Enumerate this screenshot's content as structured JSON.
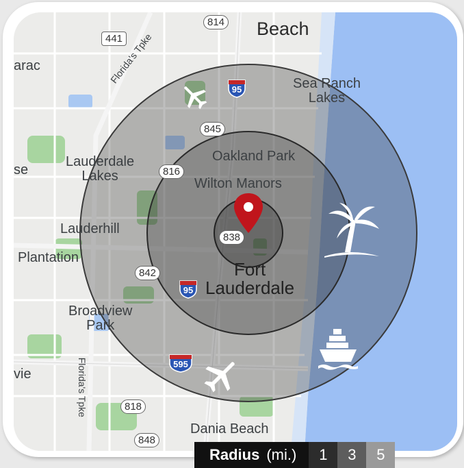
{
  "map": {
    "labels": {
      "pompano_beach": "Beach",
      "tamarac": "arac",
      "sea_ranch_lakes": "Sea Ranch\nLakes",
      "lauderdale_lakes": "Lauderdale\nLakes",
      "oakland_park": "Oakland Park",
      "wilton_manors": "Wilton Manors",
      "sunrise": "se",
      "lauderhill": "Lauderhill",
      "plantation": "Plantation",
      "fort_lauderdale": "Fort\nLauderdale",
      "broadview_park": "Broadview\nPark",
      "davie": "vie",
      "dania_beach": "Dania Beach",
      "florida_tpke_1": "Florida's Tpke",
      "florida_tpke_2": "Florida's Tpke"
    },
    "shields": {
      "s814": "814",
      "s441": "441",
      "s845": "845",
      "s816": "816",
      "s838": "838",
      "s842": "842",
      "s818": "818",
      "s848": "848",
      "i95_top": "95",
      "i95_mid": "95",
      "i595": "595"
    },
    "markers": {
      "center_pin": "map-pin-icon",
      "airport_north": "airplane-icon",
      "airport_south": "airplane-icon",
      "beach": "palm-tree-icon",
      "cruise_port": "ship-icon"
    },
    "colors": {
      "ocean": "#9cbff4",
      "radius_ring": "#1f1f1f",
      "pin": "#c0151c",
      "park": "#a8d5a0"
    }
  },
  "legend": {
    "title": "Radius",
    "unit": "(mi.)",
    "options": [
      {
        "label": "1",
        "color": "#2c2c2c"
      },
      {
        "label": "3",
        "color": "#5d5d5d"
      },
      {
        "label": "5",
        "color": "#9a9a9a"
      }
    ]
  }
}
